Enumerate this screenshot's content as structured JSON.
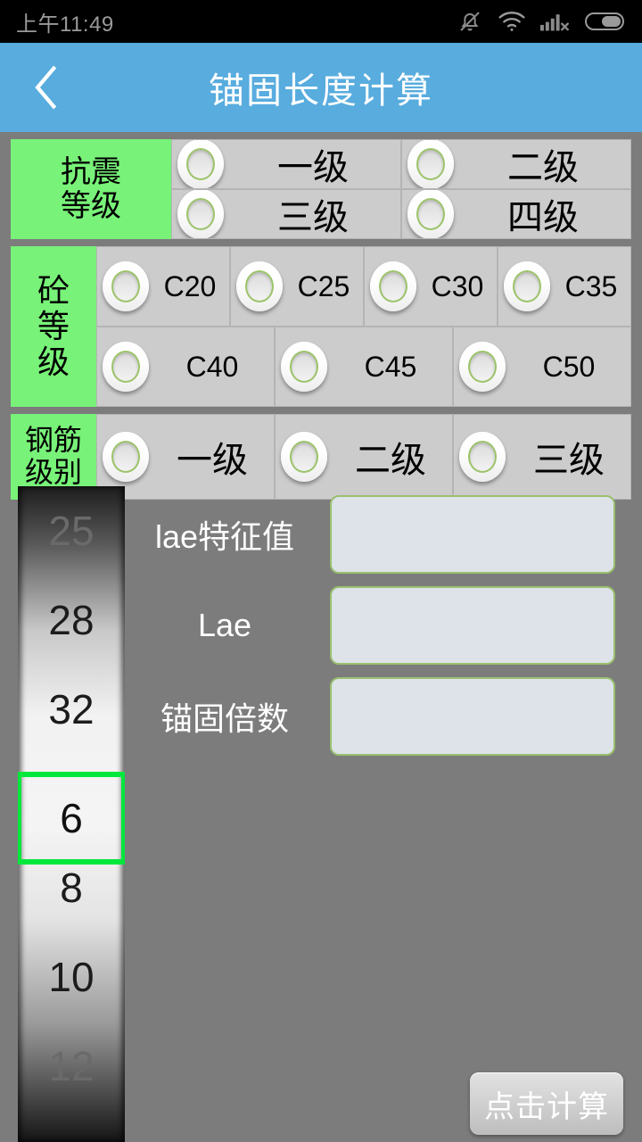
{
  "status_bar": {
    "time": "上午11:49",
    "icons": [
      "bell-muted-icon",
      "wifi-icon",
      "signal-no-service-icon",
      "battery-icon"
    ]
  },
  "title_bar": {
    "back_icon": "chevron-left-icon",
    "title": "锚固长度计算",
    "bg_color": "#58acde"
  },
  "groups": [
    {
      "key": "seismic",
      "label_lines": [
        "抗震",
        "等级"
      ],
      "rows": [
        [
          {
            "label": "一级"
          },
          {
            "label": "二级"
          }
        ],
        [
          {
            "label": "三级"
          },
          {
            "label": "四级"
          }
        ]
      ]
    },
    {
      "key": "concrete",
      "label_lines": [
        "砼",
        "等",
        "级"
      ],
      "rows": [
        [
          {
            "label": "C20"
          },
          {
            "label": "C25"
          },
          {
            "label": "C30"
          },
          {
            "label": "C35"
          }
        ],
        [
          {
            "label": "C40"
          },
          {
            "label": "C45"
          },
          {
            "label": "C50"
          }
        ]
      ]
    },
    {
      "key": "rebar",
      "label_lines": [
        "钢筋",
        "级别"
      ],
      "rows": [
        [
          {
            "label": "一级"
          },
          {
            "label": "二级"
          },
          {
            "label": "三级"
          }
        ]
      ]
    }
  ],
  "picker": {
    "items": [
      "25",
      "28",
      "32",
      "6",
      "8",
      "10",
      "12"
    ],
    "selected_value": "6",
    "selected_index": 3,
    "highlight_color": "#00e83c"
  },
  "results": [
    {
      "label": "lae特征值",
      "value": ""
    },
    {
      "label": "Lae",
      "value": ""
    },
    {
      "label": "锚固倍数",
      "value": ""
    }
  ],
  "calc_button": {
    "label": "点击计算"
  },
  "colors": {
    "background": "#7c7c7c",
    "group_label_green": "#78f278",
    "option_gray": "#cccccc",
    "field_fill": "#dde3e9",
    "field_border": "#9ac06e"
  }
}
